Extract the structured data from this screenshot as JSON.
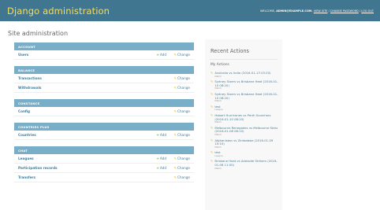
{
  "header": {
    "branding": "Django administration",
    "welcome": "WELCOME,",
    "user": "ADMIN@EXAMPLE.COM.",
    "view_site": "VIEW SITE",
    "change_password": "CHANGE PASSWORD",
    "logout": "LOG OUT",
    "separator": "/"
  },
  "page": {
    "title": "Site administration"
  },
  "labels": {
    "add": "Add",
    "change": "Change"
  },
  "modules": [
    {
      "caption": "ACCOUNT",
      "models": [
        {
          "name": "Users",
          "add": true
        }
      ]
    },
    {
      "caption": "BALANCE",
      "models": [
        {
          "name": "Transactions",
          "add": false
        },
        {
          "name": "Withdrawals",
          "add": false
        }
      ]
    },
    {
      "caption": "CONSTANCE",
      "models": [
        {
          "name": "Config",
          "add": false
        }
      ]
    },
    {
      "caption": "COUNTRIES PLUS",
      "models": [
        {
          "name": "Countries",
          "add": true
        }
      ]
    },
    {
      "caption": "CHAT",
      "models": [
        {
          "name": "Leagues",
          "add": true
        },
        {
          "name": "Participation records",
          "add": true
        },
        {
          "name": "Transfers",
          "add": false
        }
      ]
    }
  ],
  "recent": {
    "title": "Recent Actions",
    "my_actions": "My Actions",
    "items": [
      {
        "title": "Australia vs India (2016-01-13 03:20)",
        "type": "Match"
      },
      {
        "title": "Sydney Sixers vs Brisbane Heat (2016-01-10 08:20)",
        "type": "Match"
      },
      {
        "title": "Sydney Sixers vs Brisbane Heat (2016-01-10 08:20)",
        "type": "Match"
      },
      {
        "title": "test",
        "type": "League"
      },
      {
        "title": "Hobart Hurricanes vs Perth Scorchers (2016-01-10 08:20)",
        "type": "Match"
      },
      {
        "title": "Melbourne Renegades vs Melbourne Stars (2016-01-08 08:15)",
        "type": "Match"
      },
      {
        "title": "Afghanistan vs Zimbabwe (2016-01-09 10:10)",
        "type": "Match"
      },
      {
        "title": "test",
        "type": "League"
      },
      {
        "title": "Brisbane Heat vs Adelaide Strikers (2016-01-08 11:00)",
        "type": "Match"
      }
    ]
  },
  "colors": {
    "header_bg": "#417690",
    "branding": "#f5dd5d",
    "caption_bg": "#79aec8",
    "link": "#447e9b",
    "add_icon": "#70bf2b",
    "change_icon": "#efb80b"
  }
}
